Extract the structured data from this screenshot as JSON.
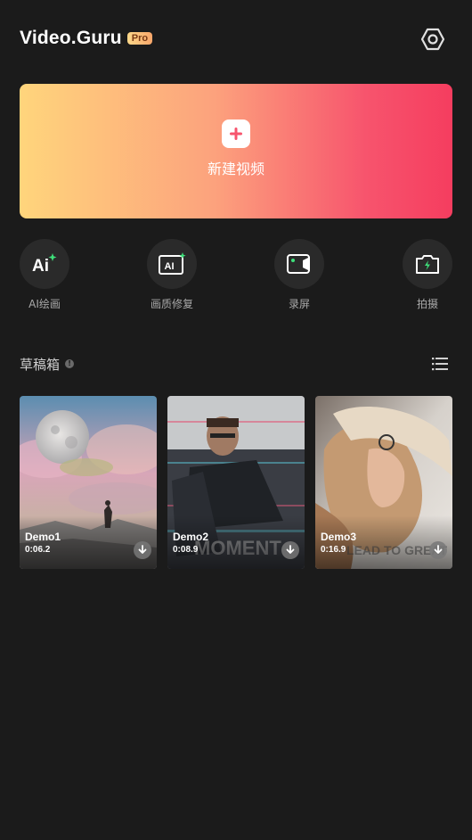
{
  "header": {
    "logo": "Video.Guru",
    "badge": "Pro",
    "settings_icon": "gear-hexagon-icon"
  },
  "new_video": {
    "label": "新建视频",
    "icon": "plus-icon",
    "gradient": [
      "#ffd57c",
      "#fca27d",
      "#f7546d",
      "#f53d5f"
    ]
  },
  "tools": [
    {
      "label": "AI绘画",
      "icon": "ai-sparkle-icon"
    },
    {
      "label": "画质修复",
      "icon": "ai-enhance-icon"
    },
    {
      "label": "录屏",
      "icon": "screen-record-icon"
    },
    {
      "label": "拍摄",
      "icon": "camera-icon"
    }
  ],
  "drafts": {
    "title": "草稿箱",
    "info_icon": "info-icon",
    "list_icon": "list-view-icon",
    "items": [
      {
        "name": "Demo1",
        "duration": "0:06.2"
      },
      {
        "name": "Demo2",
        "duration": "0:08.9"
      },
      {
        "name": "Demo3",
        "duration": "0:16.9"
      }
    ]
  },
  "colors": {
    "background": "#1b1b1b",
    "tool_circle": "#2a2a2a",
    "muted_text": "#a9a9a9",
    "sparkle_green": "#3ee07a"
  }
}
